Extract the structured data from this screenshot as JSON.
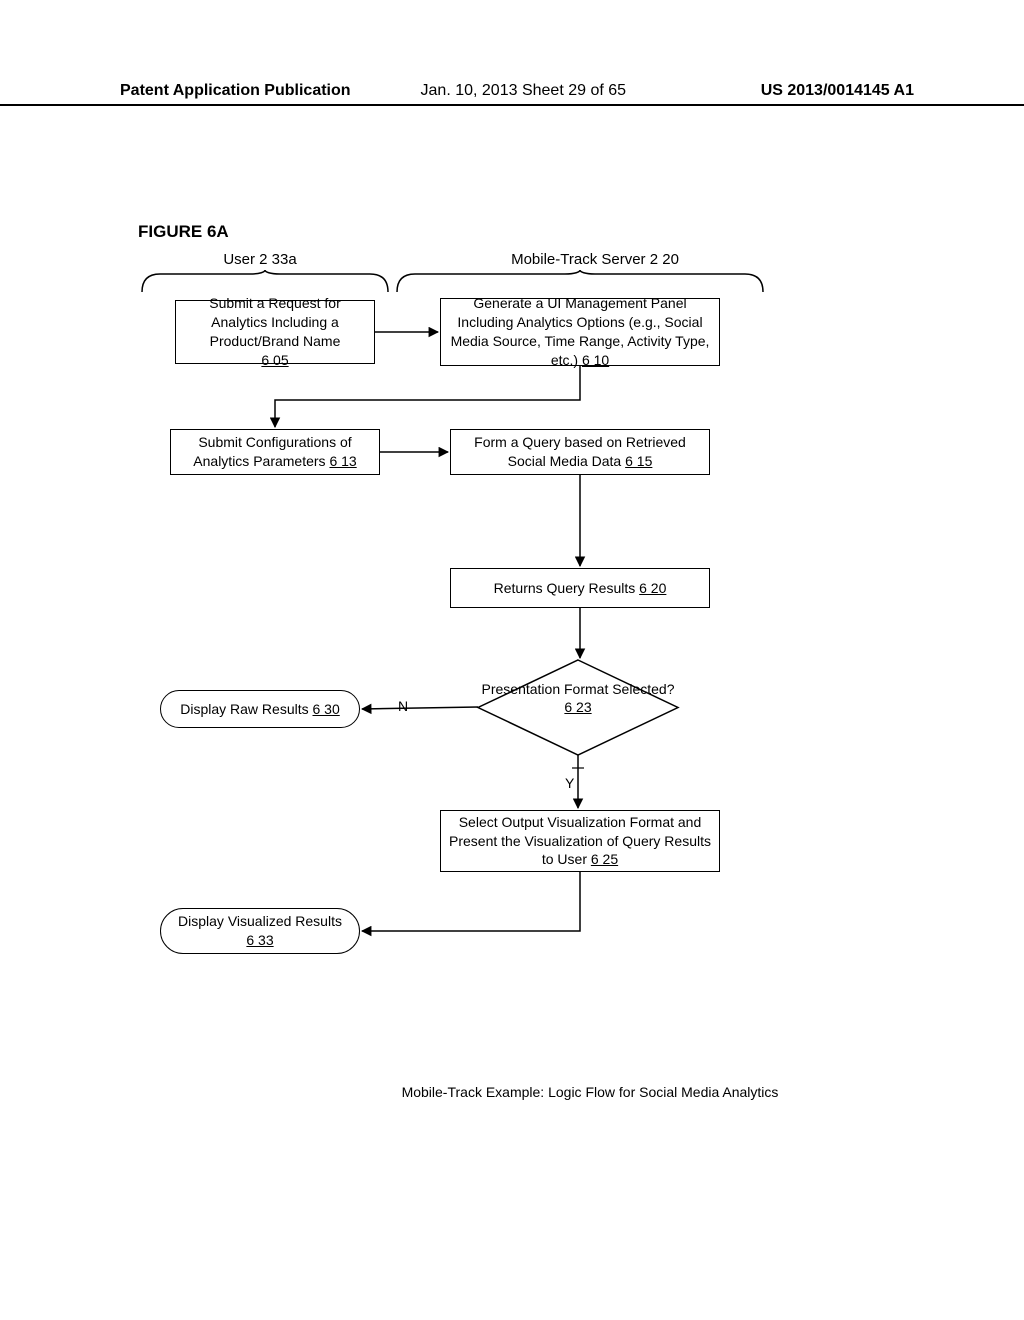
{
  "header": {
    "left": "Patent Application Publication",
    "center": "Jan. 10, 2013  Sheet 29 of 65",
    "right": "US 2013/0014145 A1"
  },
  "figure_label": "FIGURE 6A",
  "lanes": {
    "user": "User 2 33a",
    "server": "Mobile-Track Server 2 20"
  },
  "nodes": {
    "n605": {
      "text": "Submit a Request for Analytics Including a Product/Brand Name",
      "ref": "6 05"
    },
    "n610": {
      "text": "Generate a UI Management Panel Including Analytics Options (e.g., Social Media Source, Time Range, Activity Type, etc.)",
      "ref": "6 10"
    },
    "n613": {
      "text": "Submit Configurations of Analytics Parameters",
      "ref": "6 13"
    },
    "n615": {
      "text": "Form a Query based on Retrieved Social Media Data",
      "ref": "6 15"
    },
    "n620": {
      "text": "Returns Query Results",
      "ref": "6 20"
    },
    "n623": {
      "text": "Presentation Format Selected?",
      "ref": "6 23"
    },
    "n625": {
      "text": "Select Output Visualization Format and Present the Visualization of Query Results to User",
      "ref": "6 25"
    },
    "n630": {
      "text": "Display Raw Results",
      "ref": "6 30"
    },
    "n633": {
      "text": "Display Visualized Results",
      "ref": "6 33"
    }
  },
  "edges": {
    "no": "N",
    "yes": "Y"
  },
  "caption": "Mobile-Track Example: Logic Flow for Social Media Analytics"
}
